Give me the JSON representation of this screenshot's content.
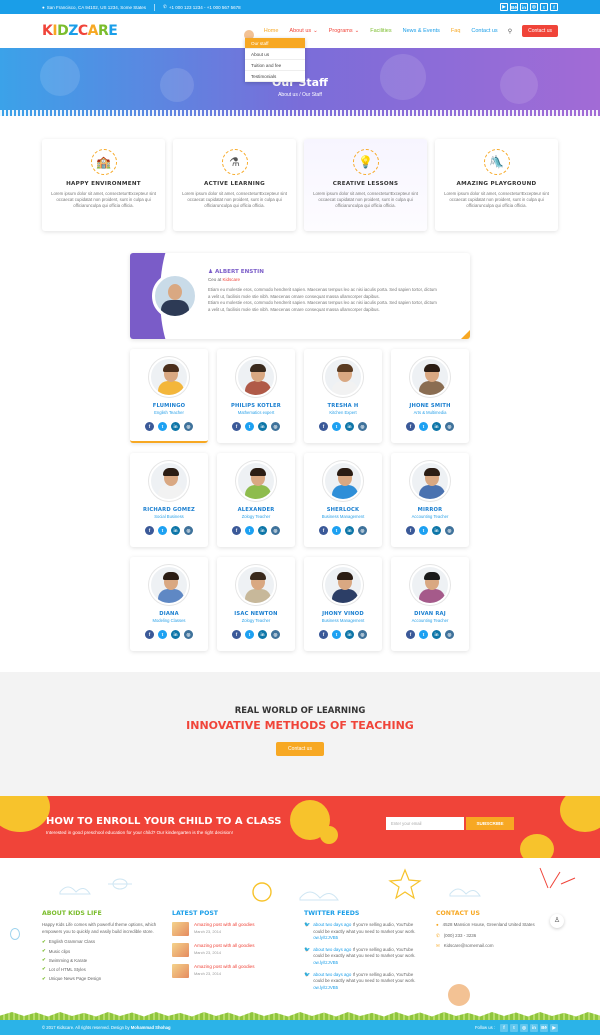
{
  "topbar": {
    "address": "San Francisco, CA 94102, US 1234, Some States",
    "phones": "+1 000 123 1234 - +1 000 567 5678",
    "socials": [
      {
        "icon": "youtube-icon",
        "glyph": "▶"
      },
      {
        "icon": "behance-icon",
        "glyph": "Bē"
      },
      {
        "icon": "linkedin-icon",
        "glyph": "in"
      },
      {
        "icon": "instagram-icon",
        "glyph": "◎"
      },
      {
        "icon": "twitter-icon",
        "glyph": "t"
      },
      {
        "icon": "facebook-icon",
        "glyph": "f"
      }
    ]
  },
  "header": {
    "logo_letters": [
      {
        "ch": "K",
        "color": "#f04439"
      },
      {
        "ch": "I",
        "color": "#f7a823"
      },
      {
        "ch": "D",
        "color": "#7bbd2d"
      },
      {
        "ch": "Z",
        "color": "#1a9ee8"
      },
      {
        "ch": "C",
        "color": "#f04439"
      },
      {
        "ch": "A",
        "color": "#f7a823"
      },
      {
        "ch": "R",
        "color": "#7bbd2d"
      },
      {
        "ch": "E",
        "color": "#1a9ee8"
      }
    ],
    "nav": [
      {
        "label": "Home",
        "color": "#f7a823"
      },
      {
        "label": "About us",
        "color": "#f04439",
        "caret": "⌄"
      },
      {
        "label": "Programs",
        "color": "#f04439",
        "caret": "⌄"
      },
      {
        "label": "Facilities",
        "color": "#7bbd2d"
      },
      {
        "label": "News & Events",
        "color": "#1a9ee8"
      },
      {
        "label": "Faq",
        "color": "#f7a823"
      },
      {
        "label": "Contact us",
        "color": "#1a9ee8"
      }
    ],
    "contact_btn": "Contact us",
    "dropdown": [
      "Our staff",
      "About us",
      "Tuition and fee",
      "Testimonials"
    ]
  },
  "hero": {
    "title": "Our Staff",
    "breadcrumb": "About us / Our Staff"
  },
  "features": [
    {
      "icon": "school-icon",
      "glyph": "🏫",
      "title": "HAPPY ENVIRONMENT",
      "text": "Lorem ipsum dolor sit amet, consectetur!Excepteur sint occaecat cupidatat non proident, sunt in culpa qui officiarunculpa qui officia officia."
    },
    {
      "icon": "flask-icon",
      "glyph": "⚗",
      "title": "ACTIVE LEARNING",
      "text": "Lorem ipsum dolor sit amet, consectetur!Excepteur sint occaecat cupidatat non proident, sunt in culpa qui officiarunculpa qui officia officia."
    },
    {
      "icon": "lightbulb-icon",
      "glyph": "💡",
      "title": "CREATIVE LESSONS",
      "text": "Lorem ipsum dolor sit amet, consectetur!Excepteur sint occaecat cupidatat non proident, sunt in culpa qui officiarunculpa qui officia officia."
    },
    {
      "icon": "playground-icon",
      "glyph": "🛝",
      "title": "AMAZING PLAYGROUND",
      "text": "Lorem ipsum dolor sit amet, consectetur!Excepteur sint occaecat cupidatat non proident, sunt in culpa qui officiarunculpa qui officia officia."
    }
  ],
  "testimonial": {
    "name": "ALBERT ENSTIN",
    "role_prefix": "Ceo at",
    "role_company": "Kidscare",
    "lines": [
      "Etiam eu molestie eros, commodo hendrerit sapien. Maecenas tempus leo ac nisi iaculis porta. Sed sapien tortor, dictum",
      "a velit ut, facilisis mole stie nibh. Maecenas ornare consequat massa ullamcorper dapibus.",
      "Etiam eu molestie eros, commodo hendrerit sapien. Maecenas tempus leo ac nisi iaculis porta. Sed sapien tortor, dictum",
      "a velit ut, facilisis mole stie nibh. Maecenas ornare consequat massa ullamcorper dapibus."
    ]
  },
  "team": [
    {
      "name": "FLUMINGO",
      "role": "English Teacher",
      "shirt": "#f3b63b",
      "hair": "#4a2e1c"
    },
    {
      "name": "PHILIPS KOTLER",
      "role": "Mathematics expert",
      "shirt": "#b05a48",
      "hair": "#3a2a1d"
    },
    {
      "name": "TRESHA H",
      "role": "Kitchen Expert",
      "shirt": "#f2f2f2",
      "hair": "#5a3b22"
    },
    {
      "name": "JHONE SMITH",
      "role": "Arts & Multimedia",
      "shirt": "#8a6d52",
      "hair": "#2b1d14"
    },
    {
      "name": "RICHARD GOMEZ",
      "role": "Social Business",
      "shirt": "#f2f2f2",
      "hair": "#2b1d14"
    },
    {
      "name": "ALEXANDER",
      "role": "Zology Teacher",
      "shirt": "#8ebc4d",
      "hair": "#2b1d14"
    },
    {
      "name": "SHERLOCK",
      "role": "Business Management",
      "shirt": "#2f8fd8",
      "hair": "#2b1d14"
    },
    {
      "name": "MIRROR",
      "role": "Accounting Teacher",
      "shirt": "#4a72b0",
      "hair": "#2b1d14"
    },
    {
      "name": "DIANA",
      "role": "Modeling Classes",
      "shirt": "#5f88c4",
      "hair": "#2b1d14"
    },
    {
      "name": "ISAC NEWTON",
      "role": "Zology Teacher",
      "shirt": "#c7b89a",
      "hair": "#3a2a1d"
    },
    {
      "name": "JHONY VINOD",
      "role": "Business Management",
      "shirt": "#2c3e66",
      "hair": "#2b1d14"
    },
    {
      "name": "DIVAN RAJ",
      "role": "Accounting Teacher",
      "shirt": "#a55a8a",
      "hair": "#1a1a1a"
    }
  ],
  "member_socials": [
    {
      "icon": "facebook-icon",
      "glyph": "f",
      "color": "#3b5998"
    },
    {
      "icon": "twitter-icon",
      "glyph": "t",
      "color": "#1da1f2"
    },
    {
      "icon": "linkedin-icon",
      "glyph": "in",
      "color": "#0e76a8"
    },
    {
      "icon": "instagram-icon",
      "glyph": "◎",
      "color": "#3f729b"
    }
  ],
  "cta": {
    "subtitle": "REAL WORLD OF LEARNING",
    "title": "INNOVATIVE METHODS OF TEACHING",
    "button": "Contact us"
  },
  "enroll": {
    "title": "HOW TO ENROLL YOUR CHILD TO A CLASS",
    "text": "Interested in good preschool education for your child? Our kindergarten is the right decision!",
    "placeholder": "Enter your email",
    "button": "SUBSCRIBE"
  },
  "footer": {
    "about": {
      "heading": "ABOUT KIDS LIFE",
      "text": "Happy Kids Life comes with powerful theme options, which empowers you to quickly and easily build incredible store.",
      "items": [
        "English Grammar Class",
        "Music clips",
        "Swimming & Karate",
        "Lot of HTML Styles",
        "Unique News Page Design"
      ]
    },
    "posts": {
      "heading": "LATEST POST",
      "items": [
        {
          "title": "Amazing post with all goodies",
          "date": "March 23, 2014"
        },
        {
          "title": "Amazing post with all goodies",
          "date": "March 23, 2014"
        },
        {
          "title": "Amazing post with all goodies",
          "date": "March 23, 2014"
        }
      ]
    },
    "twitter": {
      "heading": "TWITTER FEEDS",
      "items": [
        {
          "time": "about two days ago",
          "text": "If you're selling audio, YouTube could be exactly what you need to market your work.",
          "link": "ow.ly/tzJVB5"
        },
        {
          "time": "about two days ago",
          "text": "If you're selling audio, YouTube could be exactly what you need to market your work.",
          "link": "ow.ly/tzJVB5"
        },
        {
          "time": "about two days ago",
          "text": "If you're selling audio, YouTube could be exactly what you need to market your work.",
          "link": "ow.ly/tzJVB5"
        }
      ]
    },
    "contact": {
      "heading": "CONTACT US",
      "address": "4528 Mansion House, Greenland United States",
      "phone": "(000) 233 - 3236",
      "email": "Kidscare@somemail.com"
    }
  },
  "bottombar": {
    "copyright_prefix": "© 2017 Kidscare. All rights reserved. Design by",
    "designer": "Mohammad Shohag",
    "follow": "Follow us :",
    "socials": [
      {
        "icon": "facebook-icon",
        "glyph": "f"
      },
      {
        "icon": "twitter-icon",
        "glyph": "t"
      },
      {
        "icon": "instagram-icon",
        "glyph": "◎"
      },
      {
        "icon": "linkedin-icon",
        "glyph": "in"
      },
      {
        "icon": "behance-icon",
        "glyph": "Bē"
      },
      {
        "icon": "youtube-icon",
        "glyph": "▶"
      }
    ]
  }
}
